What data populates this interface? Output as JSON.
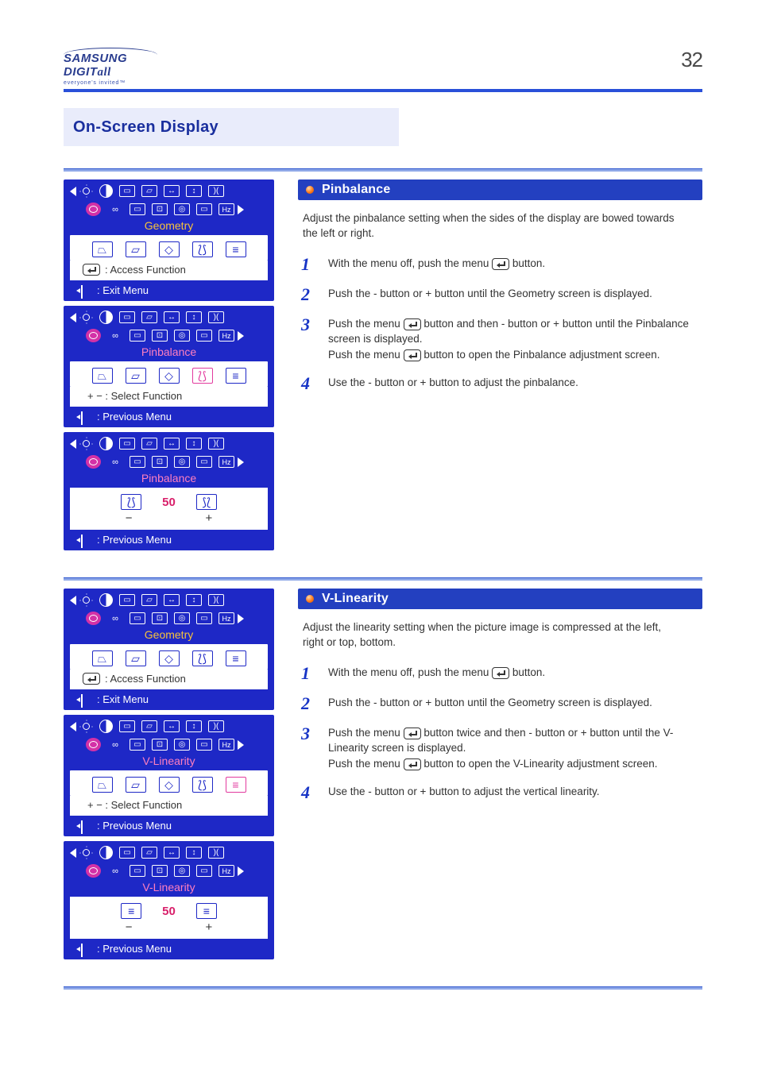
{
  "logo": {
    "brand": "SAMSUNG DIGIT",
    "brand_ital": "all",
    "tagline": "everyone's invited™"
  },
  "page_number": "32",
  "banner": {
    "left": "On-Screen Display",
    "right": "Pinbalance / V-Linearity"
  },
  "sections": [
    {
      "title": "Pinbalance",
      "desc": "Adjust the pinbalance setting when the sides of the display are bowed towards the left or right.",
      "steps": [
        "With the menu off, push the menu [enter] button.",
        "Push the - button or + button until the Geometry screen is displayed.",
        "Push the menu [enter] button and then - button or + button until the Pinbalance screen is displayed.\nPush the menu [enter] button to open the Pinbalance adjustment screen.",
        "Use the - button or + button to adjust the pinbalance."
      ],
      "osd": [
        {
          "label": "Geometry",
          "labelClass": "lbl-yellow",
          "hintIcon": "enter",
          "hint": ": Access Function",
          "sub_sel": -1,
          "foot": ": Exit Menu"
        },
        {
          "label": "Pinbalance",
          "labelClass": "lbl-pink",
          "hintPlain": "+ − : Select Function",
          "sub_sel": 3,
          "foot": ": Previous Menu"
        },
        {
          "label": "Pinbalance",
          "labelClass": "lbl-pink",
          "adj_val": "50",
          "foot": ": Previous Menu",
          "adj_glyph": "pin"
        }
      ]
    },
    {
      "title": "V-Linearity",
      "desc": "Adjust the linearity setting when the picture image is compressed at the left, right or top, bottom.",
      "steps": [
        "With the menu off, push the menu [enter] button.",
        "Push the - button or + button until the Geometry screen is displayed.",
        "Push the menu [enter] button twice and then - button or + button until the V-Linearity screen is displayed.\nPush the menu [enter] button to open the V-Linearity adjustment screen.",
        "Use the - button or + button to adjust the vertical linearity."
      ],
      "osd": [
        {
          "label": "Geometry",
          "labelClass": "lbl-yellow",
          "hintIcon": "enter",
          "hint": ": Access Function",
          "sub_sel": -1,
          "foot": ": Exit Menu"
        },
        {
          "label": "V-Linearity",
          "labelClass": "lbl-pink",
          "hintPlain": "+ − : Select Function",
          "sub_sel": 4,
          "foot": ": Previous Menu"
        },
        {
          "label": "V-Linearity",
          "labelClass": "lbl-pink",
          "adj_val": "50",
          "foot": ": Previous Menu",
          "adj_glyph": "vlin"
        }
      ]
    }
  ],
  "sub_icons": [
    "trap",
    "para",
    "rhom",
    "pin",
    "vlin"
  ]
}
